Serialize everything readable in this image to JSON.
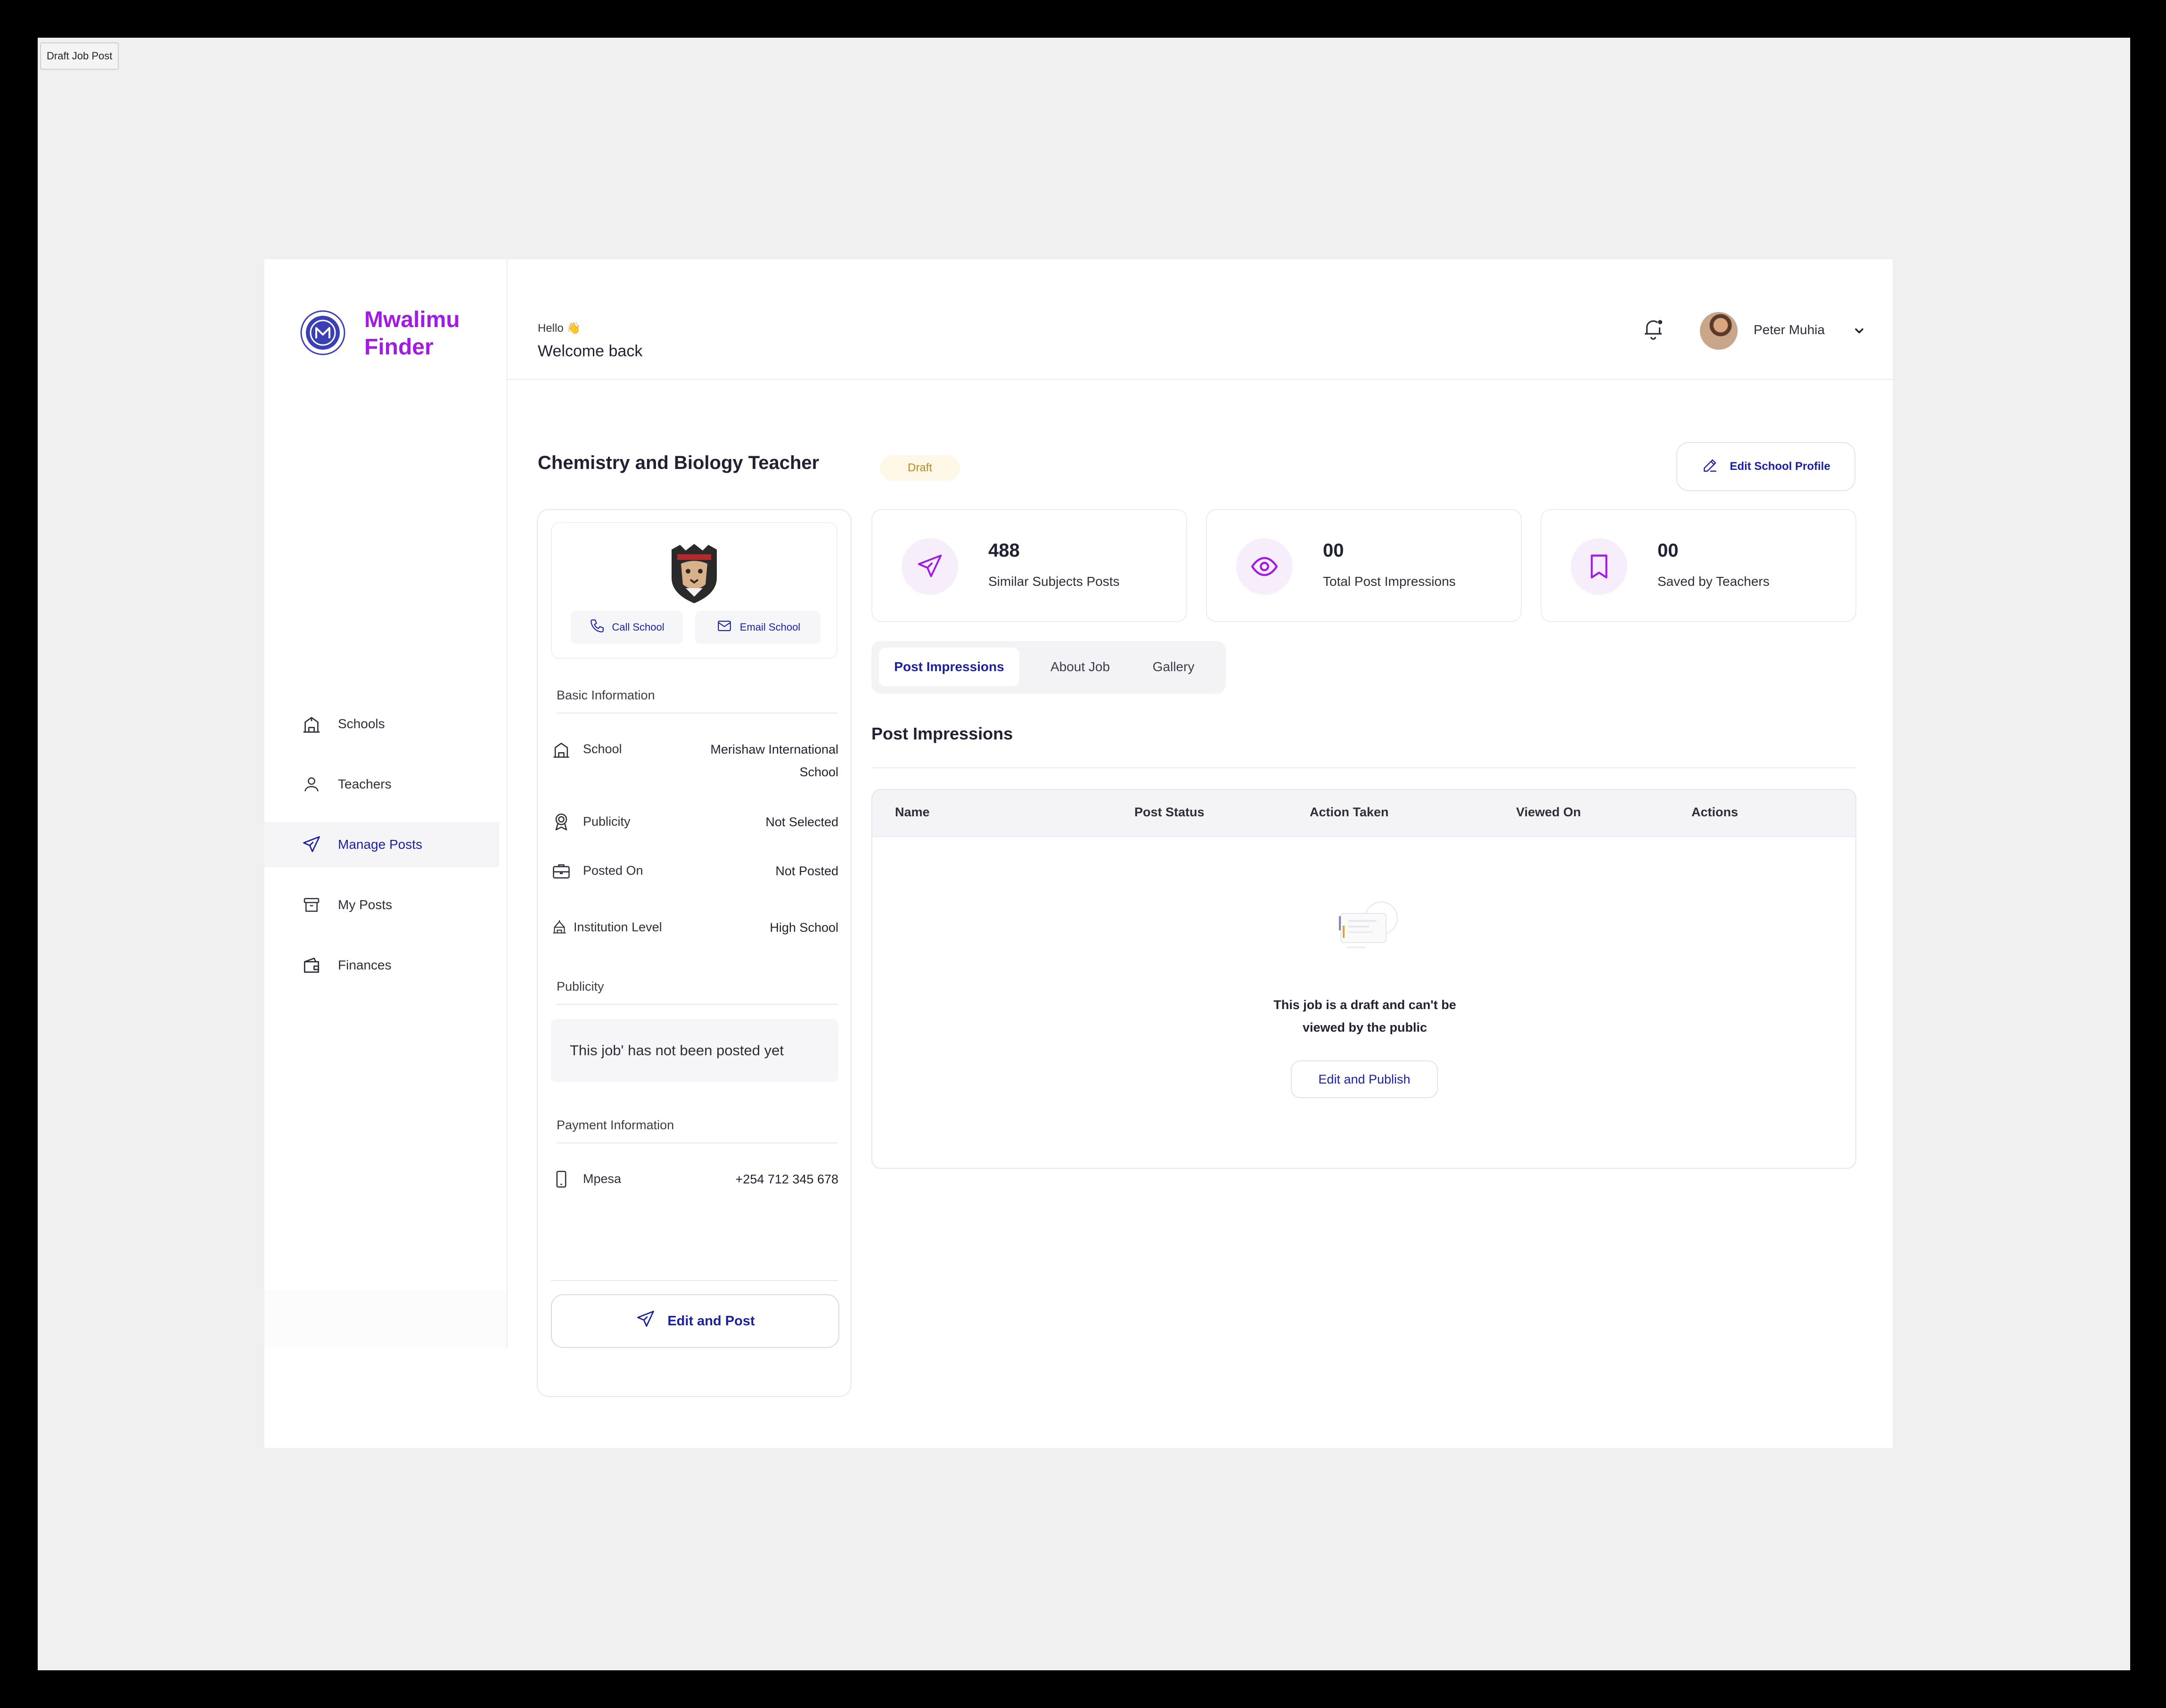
{
  "frame_label": "Draft Job Post",
  "brand": {
    "name_line1": "Mwalimu",
    "name_line2": "Finder",
    "color": "#a21be2"
  },
  "sidebar": {
    "items": [
      {
        "label": "Schools",
        "icon": "school-building-icon",
        "active": false
      },
      {
        "label": "Teachers",
        "icon": "user-icon",
        "active": false
      },
      {
        "label": "Manage Posts",
        "icon": "send-icon",
        "active": true
      },
      {
        "label": "My Posts",
        "icon": "archive-box-icon",
        "active": false
      },
      {
        "label": "Finances",
        "icon": "wallet-icon",
        "active": false
      }
    ]
  },
  "header": {
    "greeting": "Hello 👋",
    "welcome": "Welcome back",
    "user_name": "Peter Muhia"
  },
  "page": {
    "title": "Chemistry and Biology Teacher",
    "status": "Draft",
    "edit_profile_label": "Edit School Profile"
  },
  "contact": {
    "call_label": "Call School",
    "email_label": "Email School"
  },
  "basic_info": {
    "heading": "Basic Information",
    "rows": [
      {
        "label": "School",
        "value": "Merishaw International School"
      },
      {
        "label": "Publicity",
        "value": "Not Selected"
      },
      {
        "label": "Posted On",
        "value": "Not Posted"
      },
      {
        "label": "Institution Level",
        "value": "High School"
      }
    ]
  },
  "publicity": {
    "heading": "Publicity",
    "note": "This job' has not been posted yet"
  },
  "payment": {
    "heading": "Payment Information",
    "method": "Mpesa",
    "phone": "+254 712 345 678"
  },
  "edit_post_label": "Edit and Post",
  "stats": [
    {
      "value": "488",
      "label": "Similar Subjects Posts",
      "icon": "send-icon"
    },
    {
      "value": "00",
      "label": "Total Post Impressions",
      "icon": "eye-icon"
    },
    {
      "value": "00",
      "label": "Saved by Teachers",
      "icon": "bookmark-icon"
    }
  ],
  "tabs": [
    {
      "label": "Post Impressions",
      "active": true
    },
    {
      "label": "About Job",
      "active": false
    },
    {
      "label": "Gallery",
      "active": false
    }
  ],
  "impressions": {
    "title": "Post Impressions",
    "columns": [
      "Name",
      "Post Status",
      "Action Taken",
      "Viewed On",
      "Actions"
    ],
    "empty_line1": "This job is a draft and can't be",
    "empty_line2": "viewed by the public",
    "publish_label": "Edit and Publish"
  },
  "colors": {
    "accent": "#1a1f9e",
    "brand_purple": "#a21be2",
    "draft_badge_bg": "#fff8e6",
    "draft_badge_text": "#b8882a"
  }
}
